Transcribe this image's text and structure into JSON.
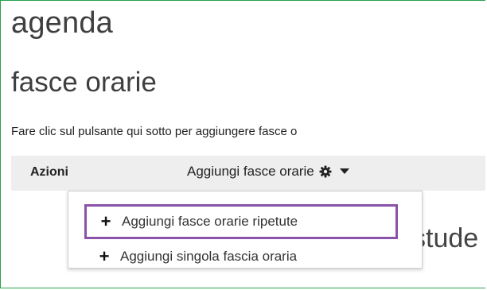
{
  "page": {
    "title": "agenda",
    "section_title": "fasce orarie"
  },
  "intro_text": "Fare clic sul pulsante qui sotto per aggiungere fasce o",
  "actions": {
    "label": "Azioni",
    "dropdown_label": "Aggiungi fasce orarie"
  },
  "menu": {
    "items": [
      {
        "label": "Aggiungi fasce orarie ripetute",
        "highlighted": true
      },
      {
        "label": "Aggiungi singola fascia oraria",
        "highlighted": false
      }
    ]
  },
  "background_text": "stude",
  "colors": {
    "frame_border": "#27a24a",
    "highlight_border": "#8a52a8",
    "actions_bg": "#eeeeee"
  },
  "icons": [
    "gear-icon",
    "caret-down-icon",
    "plus-icon"
  ]
}
